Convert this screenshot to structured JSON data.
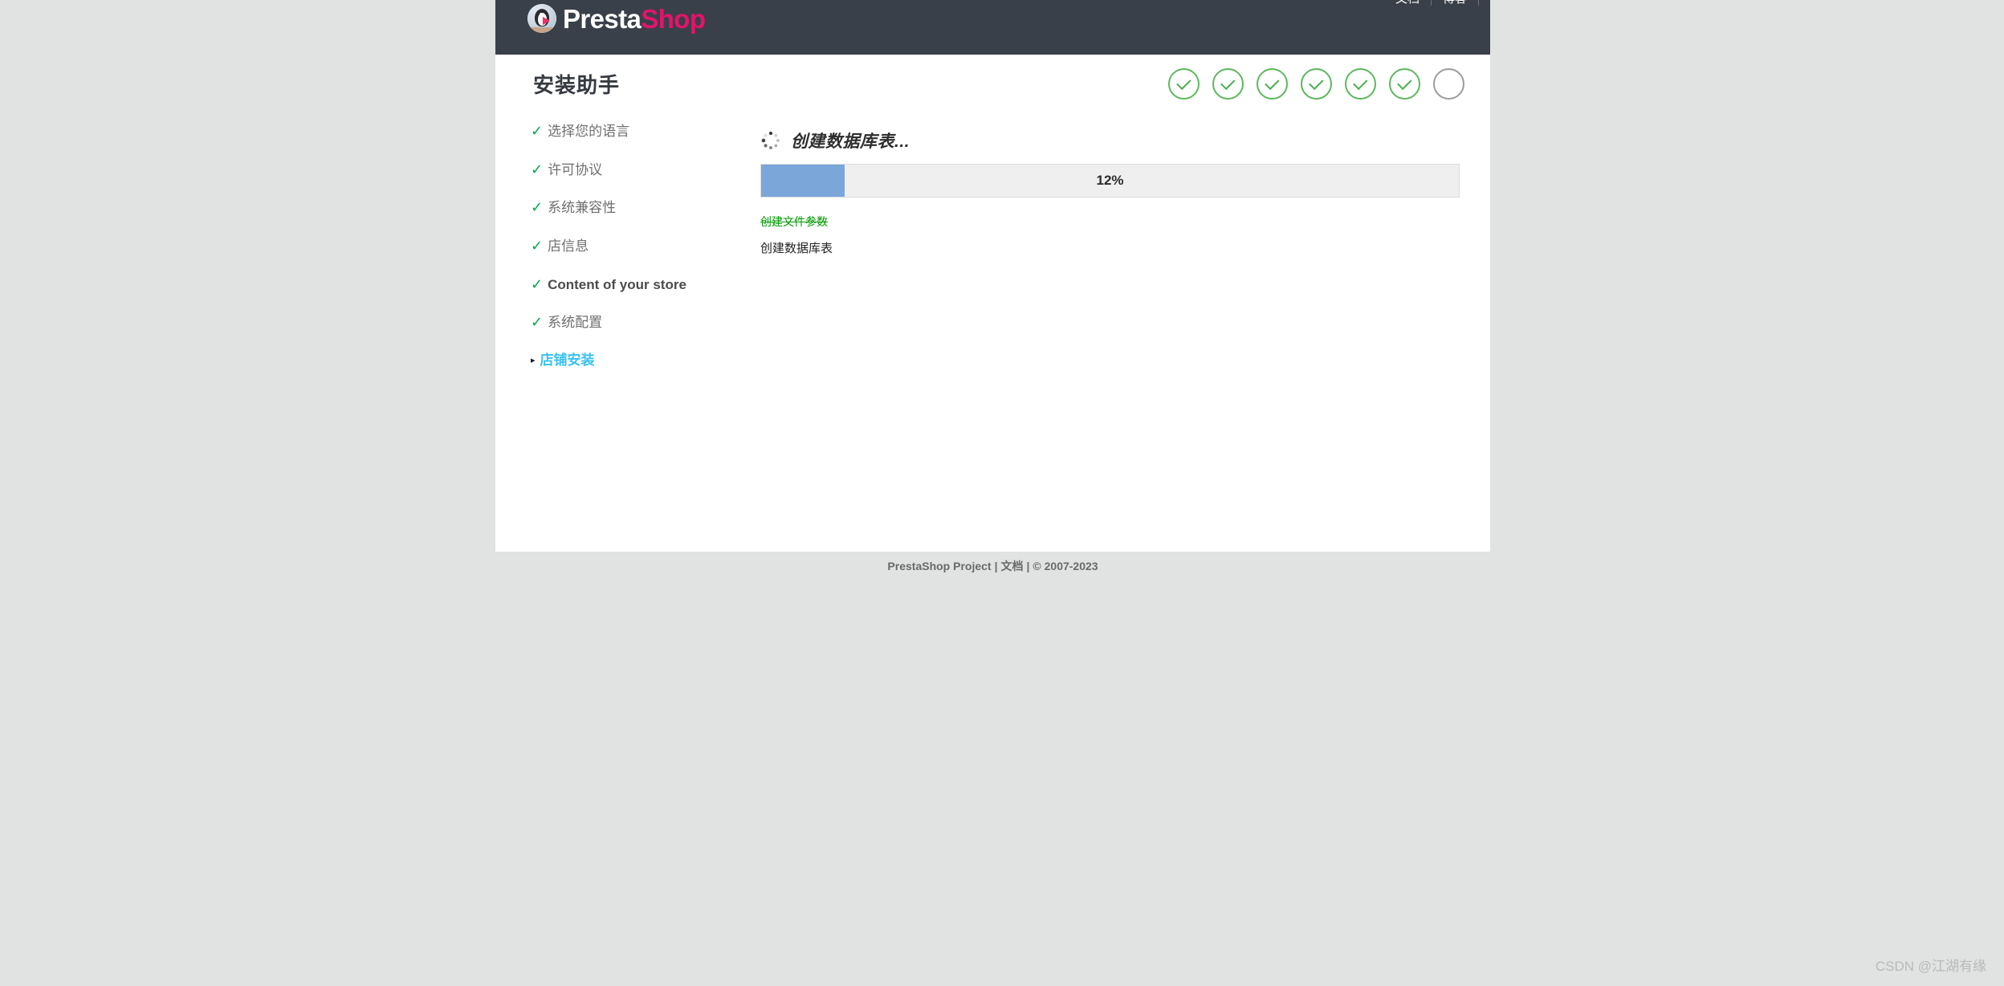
{
  "header": {
    "brand_presta": "Presta",
    "brand_shop": "Shop",
    "nav": [
      {
        "label": "文档"
      },
      {
        "label": "博客"
      }
    ]
  },
  "page": {
    "title": "安装助手"
  },
  "step_dots": [
    {
      "state": "done",
      "icon": "check-icon"
    },
    {
      "state": "done",
      "icon": "check-icon"
    },
    {
      "state": "done",
      "icon": "check-icon"
    },
    {
      "state": "done",
      "icon": "check-icon"
    },
    {
      "state": "done",
      "icon": "check-icon"
    },
    {
      "state": "done",
      "icon": "check-icon"
    },
    {
      "state": "pending",
      "icon": "empty-circle-icon"
    }
  ],
  "sidebar": {
    "items": [
      {
        "label": "选择您的语言",
        "marker": "✓",
        "state": "done"
      },
      {
        "label": "许可协议",
        "marker": "✓",
        "state": "done"
      },
      {
        "label": "系统兼容性",
        "marker": "✓",
        "state": "done"
      },
      {
        "label": "店信息",
        "marker": "✓",
        "state": "done"
      },
      {
        "label": "Content of your store",
        "marker": "✓",
        "state": "done"
      },
      {
        "label": "系统配置",
        "marker": "✓",
        "state": "done"
      },
      {
        "label": "店铺安装",
        "marker": "▸",
        "state": "current"
      }
    ]
  },
  "main": {
    "heading": "创建数据库表...",
    "progress": {
      "percent_label": "12%",
      "percent_value": 12
    },
    "log": [
      {
        "text": "创建文件参数",
        "state": "done"
      },
      {
        "text": "创建数据库表",
        "state": "active"
      }
    ]
  },
  "footer": {
    "project": "PrestaShop Project",
    "sep": "|",
    "docs": "文档",
    "copyright": "© 2007-2023"
  },
  "watermark": {
    "text": "CSDN @江湖有缘"
  },
  "colors": {
    "header_bg": "#3a4049",
    "brand_pink": "#e4136c",
    "check_green": "#00a84f",
    "dot_green": "#5cb85c",
    "current_blue": "#39c2ef",
    "progress_blue": "#7aa6da",
    "progress_track": "#efefef",
    "log_done_green": "#009900",
    "page_bg": "#e1e2e2"
  }
}
